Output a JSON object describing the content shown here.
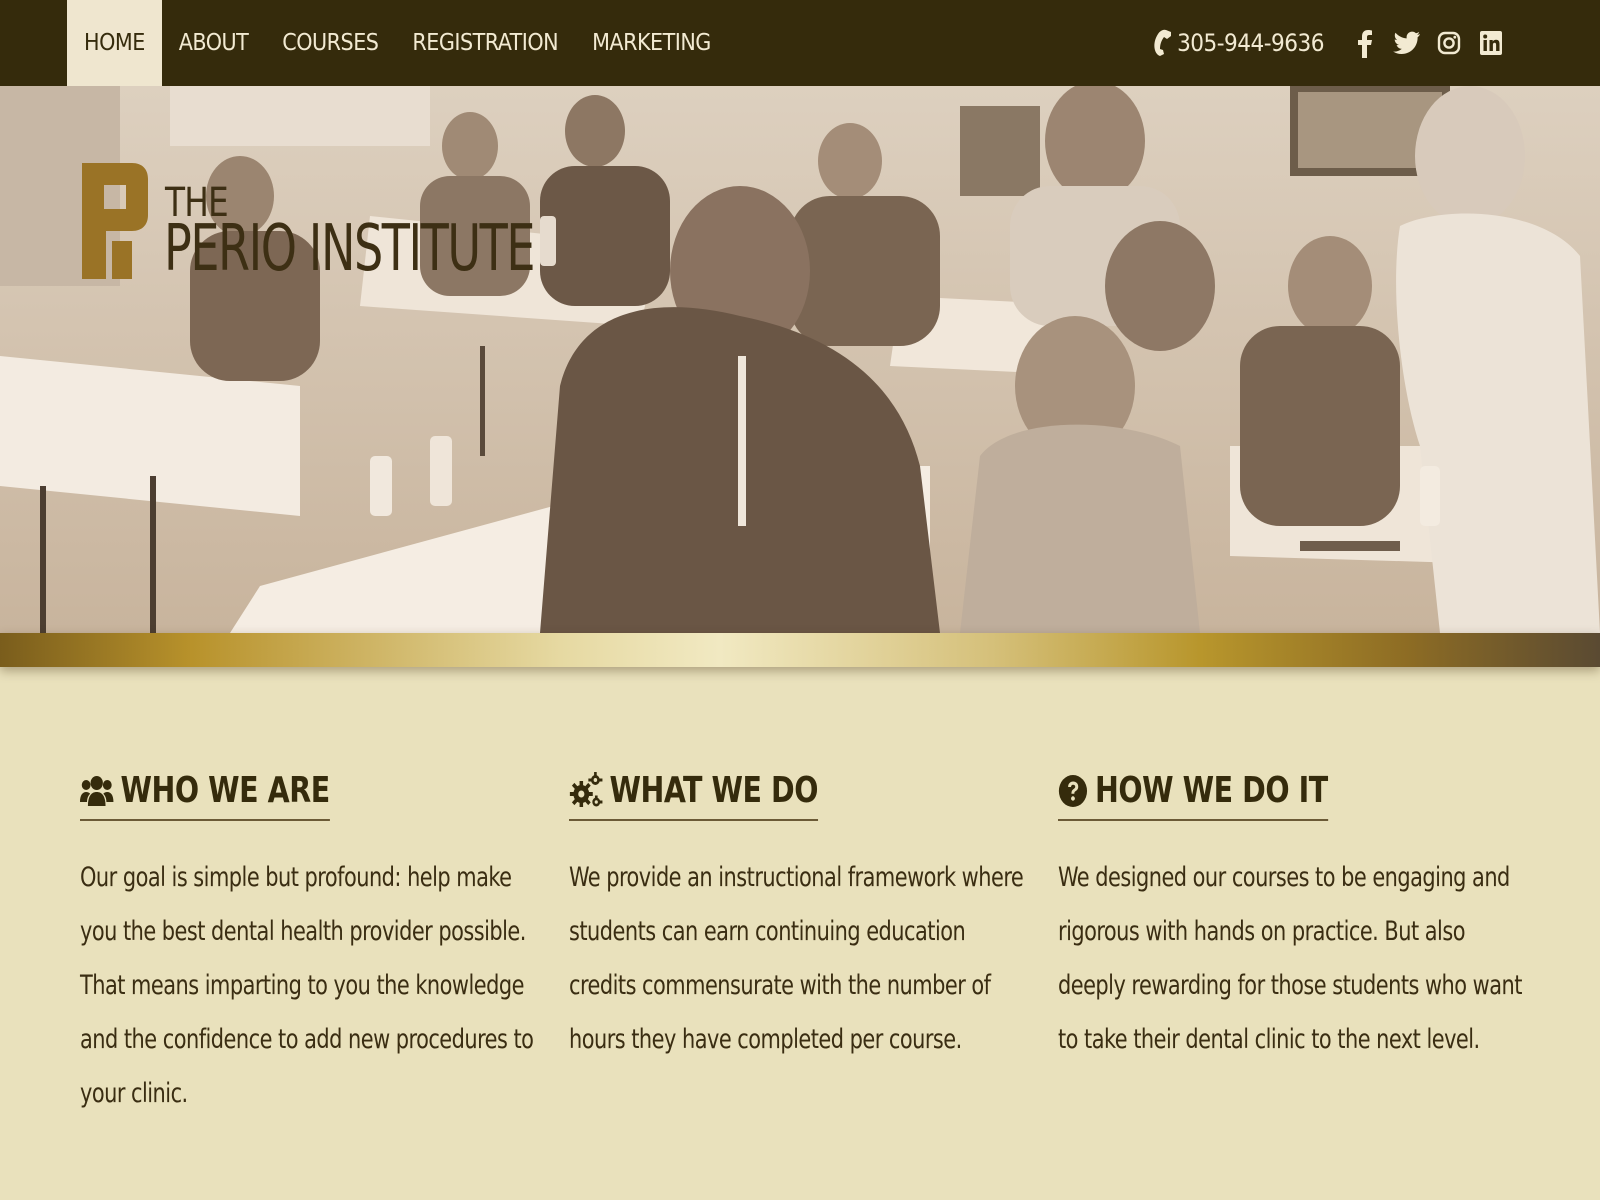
{
  "nav": {
    "items": [
      {
        "label": "HOME",
        "active": true
      },
      {
        "label": "ABOUT"
      },
      {
        "label": "COURSES"
      },
      {
        "label": "REGISTRATION"
      },
      {
        "label": "MARKETING"
      }
    ],
    "phone": "305-944-9636",
    "social_icons": [
      "facebook-icon",
      "twitter-icon",
      "instagram-icon",
      "linkedin-icon"
    ]
  },
  "logo": {
    "the": "THE",
    "name": "PERIO INSTITUTE"
  },
  "columns": [
    {
      "icon": "users-icon",
      "title": "WHO WE ARE",
      "text": "Our goal is simple but profound: help make you the best dental health provider possible. That means imparting to you the knowledge and the confidence to add new procedures to your clinic."
    },
    {
      "icon": "gears-icon",
      "title": "WHAT WE DO",
      "text": "We provide an instructional framework where students can earn continuing education credits commensurate with the number of hours they have completed per course."
    },
    {
      "icon": "question-circle-icon",
      "title": "HOW WE DO IT",
      "text": "We designed our courses to be engaging and rigorous with hands on practice. But also deeply rewarding for those students who want to take their dental clinic to the next level."
    }
  ],
  "colors": {
    "nav_bg": "#352b0c",
    "page_bg": "#e9e1bc",
    "accent_gold": "#b8922b",
    "text_dark": "#352b0c"
  }
}
